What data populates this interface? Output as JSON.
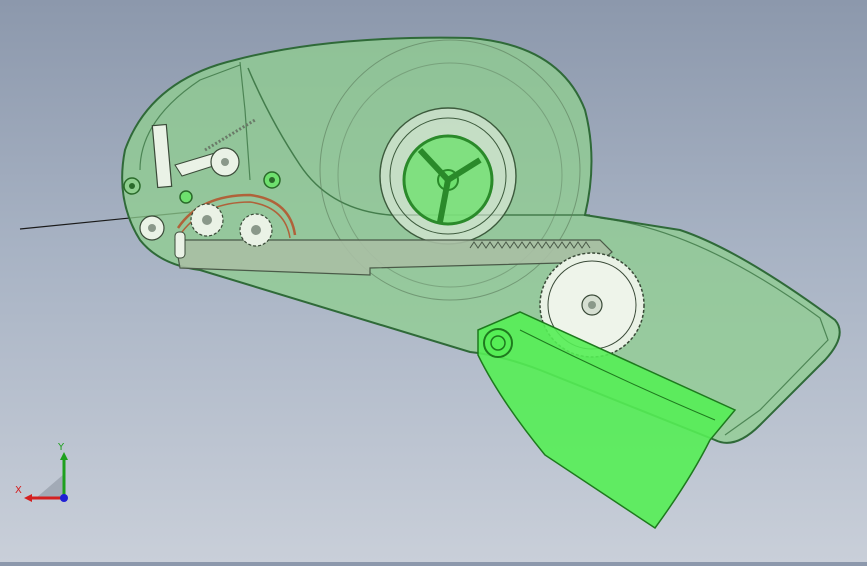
{
  "viewport": {
    "background_top": "#8c98ac",
    "background_bottom": "#c9cfd9"
  },
  "model": {
    "housing_color": "#8fcf8f",
    "housing_edge": "#2f6a38",
    "lever_color": "#55ee55",
    "gear_color": "#eaf2e6",
    "spring_color": "#b0623a"
  },
  "triad": {
    "x_label": "X",
    "y_label": "Y",
    "x_color": "#d42020",
    "y_color": "#1ea01e",
    "z_color": "#2020d4"
  }
}
